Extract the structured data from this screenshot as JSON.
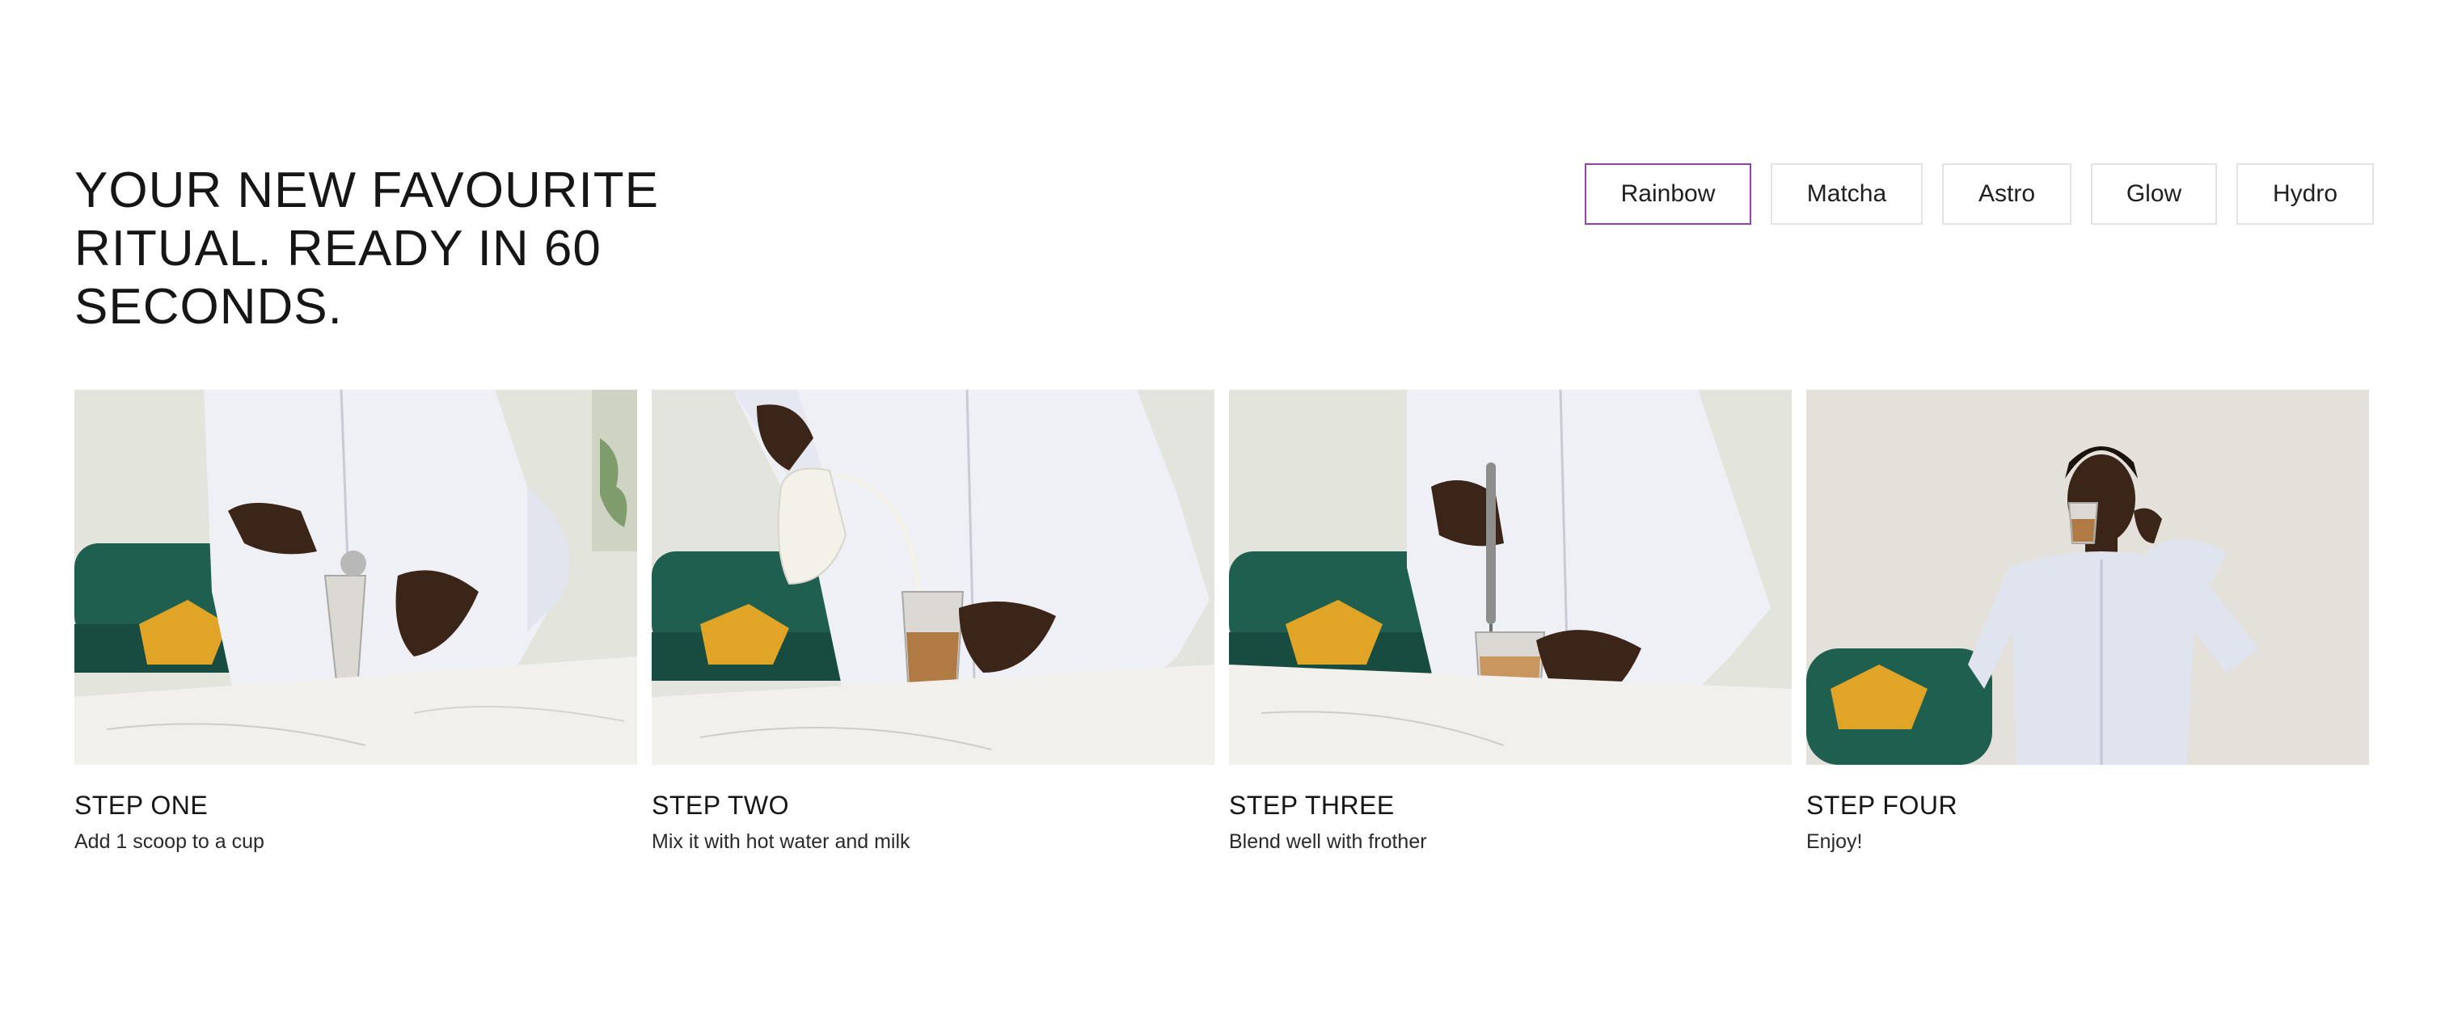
{
  "headline": "YOUR NEW FAVOURITE RITUAL. READY IN 60 SECONDS.",
  "flavour_tabs": [
    {
      "label": "Rainbow",
      "active": true
    },
    {
      "label": "Matcha",
      "active": false
    },
    {
      "label": "Astro",
      "active": false
    },
    {
      "label": "Glow",
      "active": false
    },
    {
      "label": "Hydro",
      "active": false
    }
  ],
  "steps": [
    {
      "title": "STEP ONE",
      "description": "Add 1 scoop to a cup",
      "image": "man-scooping-powder-into-glass-photo"
    },
    {
      "title": "STEP TWO",
      "description": "Mix it with hot water and milk",
      "image": "man-pouring-milk-into-glass-photo"
    },
    {
      "title": "STEP THREE",
      "description": "Blend well with frother",
      "image": "man-frothing-latte-photo"
    },
    {
      "title": "STEP FOUR",
      "description": "Enjoy!",
      "image": "man-drinking-latte-photo"
    }
  ],
  "colors": {
    "active_tab_border": "#8e44ad",
    "tab_border": "#e4e4e4",
    "text": "#161616",
    "sofa_green": "#1f5f4f",
    "cushion_yellow": "#e0a526",
    "latte": "#b07a45"
  }
}
